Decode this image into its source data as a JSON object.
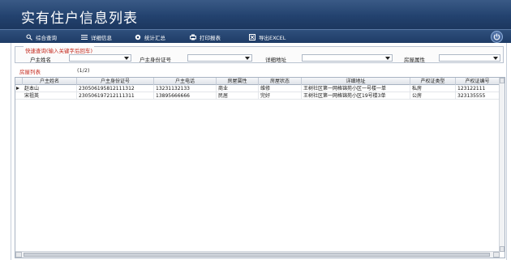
{
  "window": {
    "title": "实有住户信息列表"
  },
  "toolbar": {
    "items": [
      {
        "label": "综合查询",
        "icon": "search-icon"
      },
      {
        "label": "详细信息",
        "icon": "list-icon"
      },
      {
        "label": "统计汇总",
        "icon": "circle-icon"
      },
      {
        "label": "打印报表",
        "icon": "print-icon"
      },
      {
        "label": "导出EXCEL",
        "icon": "export-icon"
      }
    ],
    "power_icon": "power-icon"
  },
  "search": {
    "legend": "快速查询(输入关键字后回车)",
    "fields": [
      {
        "label": "户主姓名",
        "value": ""
      },
      {
        "label": "户主身份证号",
        "value": ""
      },
      {
        "label": "详细地址",
        "value": ""
      },
      {
        "label": "房屋属性",
        "value": ""
      }
    ]
  },
  "list": {
    "title": "房屋列表",
    "page": "(1/2)",
    "columns": [
      "户主姓名",
      "户主身份证号",
      "户主电话",
      "房屋属性",
      "房屋状态",
      "详细地址",
      "产权证类型",
      "产权证编号"
    ],
    "rows": [
      [
        "赵本山",
        "230506195812111312",
        "13231132133",
        "商业",
        "维修",
        "王树社区第一网格锦苑小区一号楼一单",
        "私房",
        "123122111"
      ],
      [
        "宋祖英",
        "230506197212111311",
        "13895666666",
        "民居",
        "完好",
        "王树社区第一网格锦苑小区19号楼3单",
        "公房",
        "323135555"
      ]
    ]
  },
  "colors": {
    "title_bg": "#23426f",
    "accent_red": "#c4281c"
  }
}
